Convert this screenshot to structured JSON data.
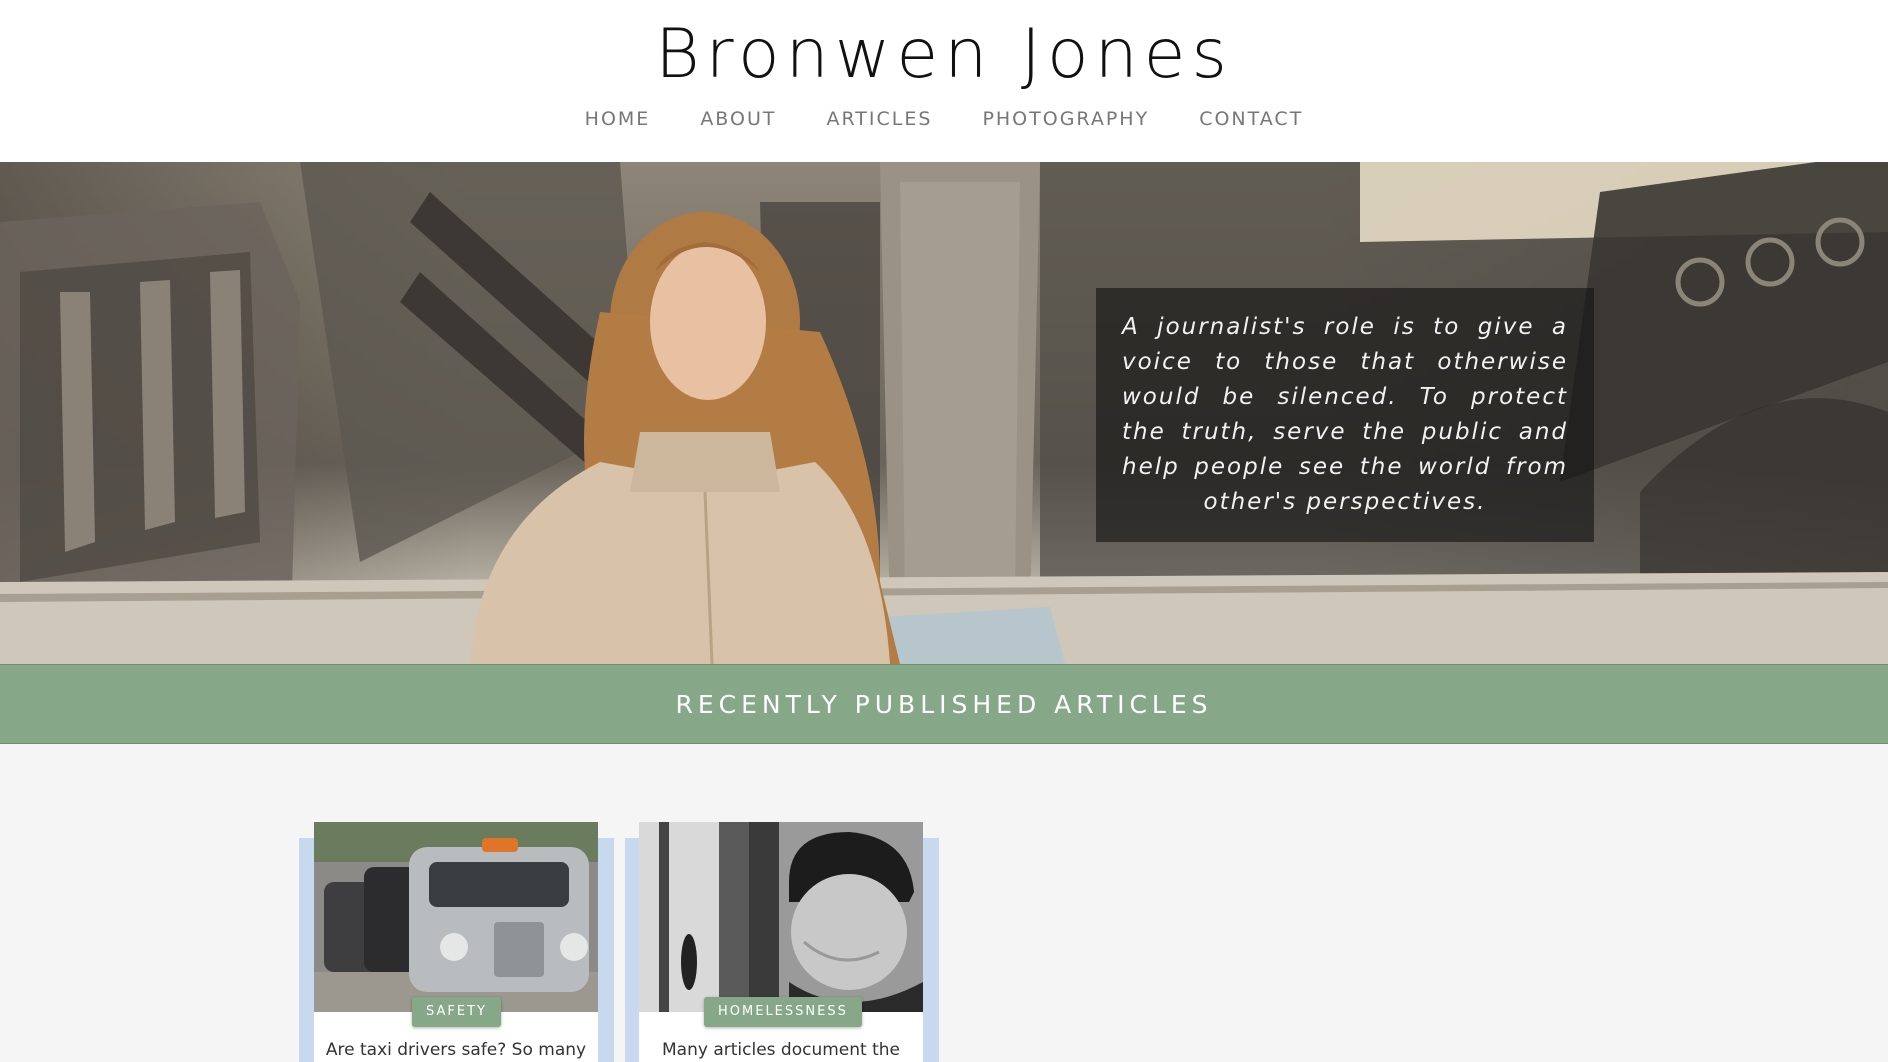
{
  "header": {
    "site_title": "Bronwen Jones",
    "nav": [
      "HOME",
      "ABOUT",
      "ARTICLES",
      "PHOTOGRAPHY",
      "CONTACT"
    ]
  },
  "hero": {
    "quote": "A journalist's role is to give a voice to those that otherwise would be silenced. To protect the truth, serve the public and help people see the world from other's perspectives."
  },
  "section": {
    "title": "RECENTLY PUBLISHED ARTICLES"
  },
  "articles": [
    {
      "tag": "SAFETY",
      "excerpt": "Are taxi drivers safe? So many"
    },
    {
      "tag": "HOMELESSNESS",
      "excerpt": "Many articles document the"
    }
  ],
  "colors": {
    "accent_green": "#86a888",
    "background": "#f5f5f5"
  }
}
